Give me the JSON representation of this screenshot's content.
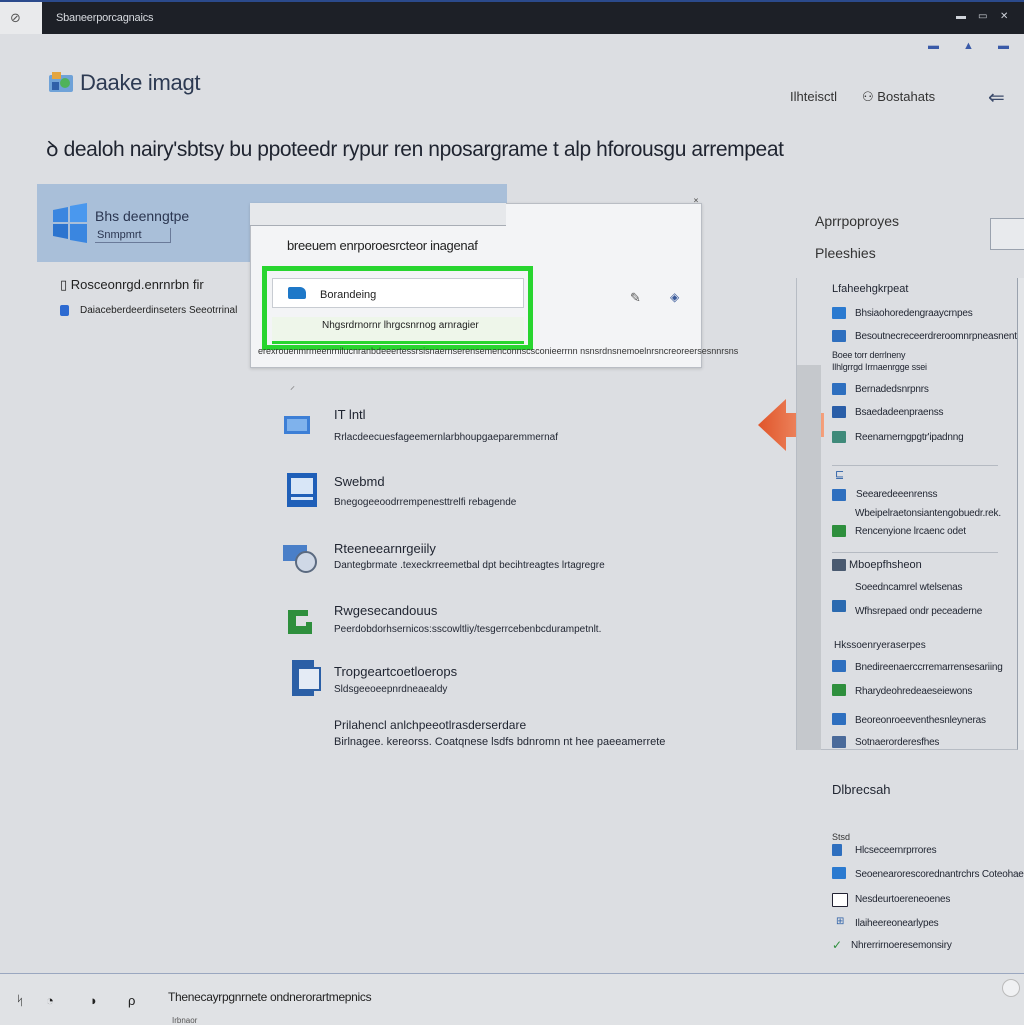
{
  "titlebar": {
    "title": "Sbaneerporcagnaics",
    "sys_icon": "⊘",
    "controls": [
      "▬",
      "▭",
      "✕"
    ]
  },
  "top_indicators": [
    "▬",
    "▲",
    "▬"
  ],
  "header": {
    "app_title": "Daake imagt",
    "link1": "Ilhteisctl",
    "link2": "Bostahats",
    "back_icon": "⇐"
  },
  "headline": "dealoh nairy'sbtsy bu ppoteedr rypur ren nposargrame t alp hforousgu arrempeat",
  "banner": {
    "title": "Bhs deenngtpe",
    "subtitle": "Snmpmrt"
  },
  "left_list": {
    "line1": "Rosceonrgd.enrnrbn fir",
    "line2": "Daiaceberdeerdinseters Seeotrrinal"
  },
  "dialog": {
    "title": "breeuem enrporoesrcteor inagenaf",
    "close_icon": "˟",
    "row1_label": "Borandeing",
    "row2_label": "Nhgsrdrnornr lhrgcsnrnog arnragier",
    "status": "erexrouenmrmeenrnilucnranbdeeertessrsisnaernserensemenconnscsconieerrnn nsnsrdnsnemoelnrsncreoreersesnnrsns",
    "edit_icon": "✎",
    "tag_icon": "◈"
  },
  "features": [
    {
      "title": "IT lntl",
      "desc": "Rrlacdeecuesfageemernlarbhoupgaeparemmernaf"
    },
    {
      "title": "Swebmd",
      "desc": "Bnegogeeoodrrempenesttrelfi rebagende"
    },
    {
      "title": "Rteeneearnrgeiily",
      "desc": "Dantegbrmate .texeckrreemetbal dpt becihtreagtes lrtagregre"
    },
    {
      "title": "Rwgesecandouus",
      "desc": "Peerdobdorhsernicos:sscowltliy/tesgerrcebenbcdurampetnlt."
    },
    {
      "title": "Tropgeartcoetloerops",
      "desc": "Sldsgeeoeepnrdneaealdy"
    },
    {
      "title": "Prilahencl anlchpeeotlrasderserdare",
      "desc": "Birlnagee. kereorss. Coatqnese lsdfs bdnromn nt hee paeeamerrete"
    }
  ],
  "right_panel": {
    "label1": "Aprrpoproyes",
    "label2": "Pleeshies",
    "head1": "Lfaheehgkrpeat",
    "items_a": [
      "Bhsiaohoredengraaycrnpes",
      "Besoutnecreceerdreroomnrpneasnent",
      "Boee torr derrlneny",
      "Ilhlgrrgd Irrnaenrgge ssei"
    ],
    "items_b": [
      "Bernadedsnrpnrs",
      "Bsaedadeenpraenss",
      "Reenarnerngpgtr'ipadnng"
    ],
    "items_c": [
      "Seearedeeenrenss",
      "Wbeipelraetonsiantengobuedr.rek.",
      "Rencenyione lrcaenc odet"
    ],
    "head2": "Mboepfhsheon",
    "items_d": [
      "Soeedncamrel wtelsenas",
      "Wfhsrepaed ondr peceaderne"
    ],
    "head3": "Hkssoenryeraserpes",
    "items_e": [
      "Bnedireenaerccrremarrensesariing",
      "Rharydeohredeaeseiewons",
      "Beoreonroeeventhesnleyneras",
      "Sotnaerorderesfhes"
    ],
    "bottom_head": "Dlbrecsah",
    "bottom_sub": "Stsd",
    "bottom_items": [
      "Hlcseceernrprrores",
      "Seoenearorescorednantrchrs Coteohaee",
      "Nesdeurtoereneoenes",
      "Ilaiheereonearlypes",
      "Nhrerrirnoeresemonsiry"
    ]
  },
  "statusbar": {
    "text": "Thenecayrpgnrnete ondnerorartmepnics",
    "sub": "Irbnaor",
    "icons": [
      "ᛋ",
      "◔",
      "◗",
      "ρ"
    ]
  },
  "colors": {
    "accent_green": "#28d52f",
    "accent_orange": "#e86a3c",
    "banner_blue": "#a9bfd9"
  }
}
